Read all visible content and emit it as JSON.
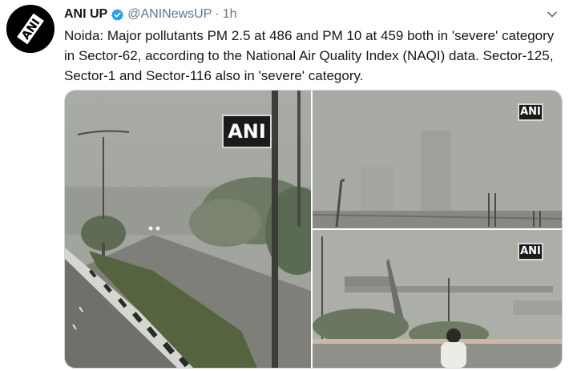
{
  "tweet": {
    "author_name": "ANI UP",
    "author_handle": "@ANINewsUP",
    "separator": "·",
    "time": "1h",
    "text": "Noida: Major pollutants PM 2.5 at 486 and PM 10 at 459 both in 'severe' category in Sector-62, according to the National Air Quality Index (NAQI) data. Sector-125, Sector-1 and Sector-116 also in 'severe' category.",
    "avatar_logo_text": "ANI",
    "verified": true
  },
  "media": {
    "watermarks": [
      "ANI",
      "ANI",
      "ANI"
    ]
  },
  "icons": {
    "verified": "verified-badge-icon",
    "menu": "chevron-down-icon"
  },
  "colors": {
    "name": "#14171a",
    "secondary": "#657786",
    "verified": "#1da1f2",
    "border": "#ccd6dd"
  }
}
